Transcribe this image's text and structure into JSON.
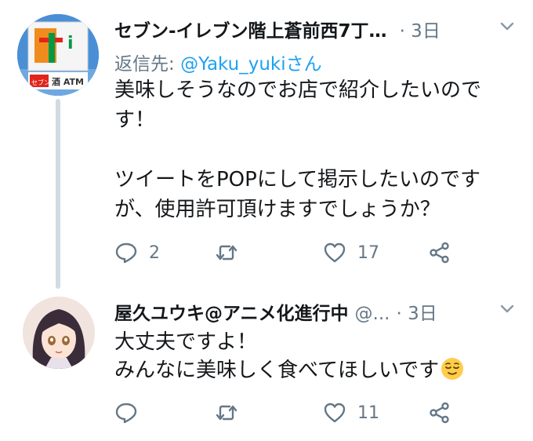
{
  "tweets": [
    {
      "author_name": "セブン-イレブン階上蒼前西7丁…",
      "handle": "",
      "time": "· 3日",
      "reply_prefix": "返信先: ",
      "reply_mention": "@Yaku_yukiさん",
      "text": "美味しそうなのでお店で紹介したいので\nす！\n\nツイートをPOPにして掲示したいのです\nが、使用許可頂けますでしょうか？",
      "reply_count": "2",
      "retweet_count": "",
      "like_count": "17",
      "avatar": "seven-eleven-sign",
      "avatar_sign_text": "セブン",
      "avatar_sign_text2": "酒 ATM"
    },
    {
      "author_name": "屋久ユウキ@アニメ化進行中",
      "handle": "@...",
      "time": "· 3日",
      "text": "大丈夫ですよ！\nみんなに美味しく食べてほしいです",
      "emoji": "relieved-face",
      "reply_count": "",
      "retweet_count": "",
      "like_count": "11",
      "avatar": "anime-girl-portrait"
    }
  ],
  "colors": {
    "text": "#14171a",
    "secondary": "#657786",
    "link": "#1da1f2",
    "thread_line": "#d3dbe2"
  }
}
